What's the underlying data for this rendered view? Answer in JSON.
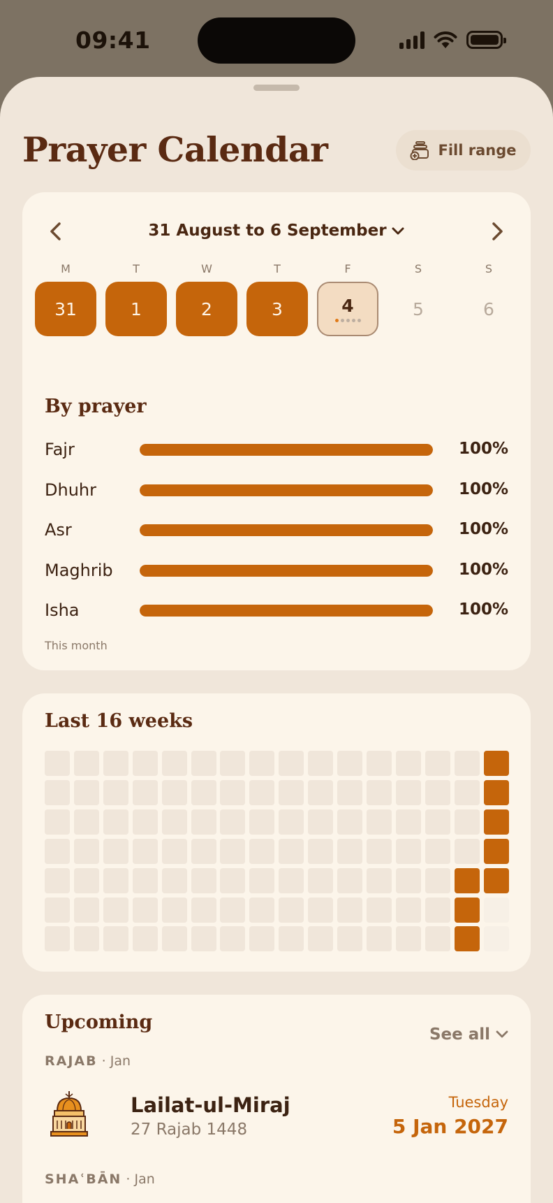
{
  "status_bar": {
    "time": "09:41"
  },
  "header": {
    "title": "Prayer Calendar",
    "fill_range_label": "Fill range"
  },
  "calendar": {
    "range_label": "31 August to 6 September",
    "weekdays": [
      "M",
      "T",
      "W",
      "T",
      "F",
      "S",
      "S"
    ],
    "days": [
      {
        "label": "31",
        "state": "done"
      },
      {
        "label": "1",
        "state": "done"
      },
      {
        "label": "2",
        "state": "done"
      },
      {
        "label": "3",
        "state": "done"
      },
      {
        "label": "4",
        "state": "today",
        "prayers_done": 1,
        "prayers_total": 5
      },
      {
        "label": "5",
        "state": "future"
      },
      {
        "label": "6",
        "state": "future"
      }
    ]
  },
  "by_prayer": {
    "title": "By prayer",
    "rows": [
      {
        "name": "Fajr",
        "percent": 100,
        "label": "100%"
      },
      {
        "name": "Dhuhr",
        "percent": 100,
        "label": "100%"
      },
      {
        "name": "Asr",
        "percent": 100,
        "label": "100%"
      },
      {
        "name": "Maghrib",
        "percent": 100,
        "label": "100%"
      },
      {
        "name": "Isha",
        "percent": 100,
        "label": "100%"
      }
    ],
    "note": "This month"
  },
  "weeks": {
    "title": "Last 16 weeks",
    "week_count": 16,
    "days_per_week": 7,
    "completed_cells": [
      [
        14,
        4
      ],
      [
        14,
        5
      ],
      [
        14,
        6
      ],
      [
        15,
        0
      ],
      [
        15,
        1
      ],
      [
        15,
        2
      ],
      [
        15,
        3
      ],
      [
        15,
        4
      ]
    ],
    "future_cells": [
      [
        15,
        5
      ],
      [
        15,
        6
      ]
    ]
  },
  "upcoming": {
    "title": "Upcoming",
    "see_all_label": "See all",
    "groups": [
      {
        "month": "RAJAB",
        "sub": "· Jan",
        "event": {
          "icon": "dome-of-the-rock-icon",
          "name": "Lailat-ul-Miraj",
          "hijri": "27 Rajab 1448",
          "weekday": "Tuesday",
          "date": "5 Jan 2027"
        }
      },
      {
        "month": "SHAʿBĀN",
        "sub": "· Jan"
      }
    ]
  },
  "colors": {
    "accent": "#c5650b",
    "background": "#f0e6da",
    "card": "#fcf5ea",
    "title": "#5a2a12"
  }
}
